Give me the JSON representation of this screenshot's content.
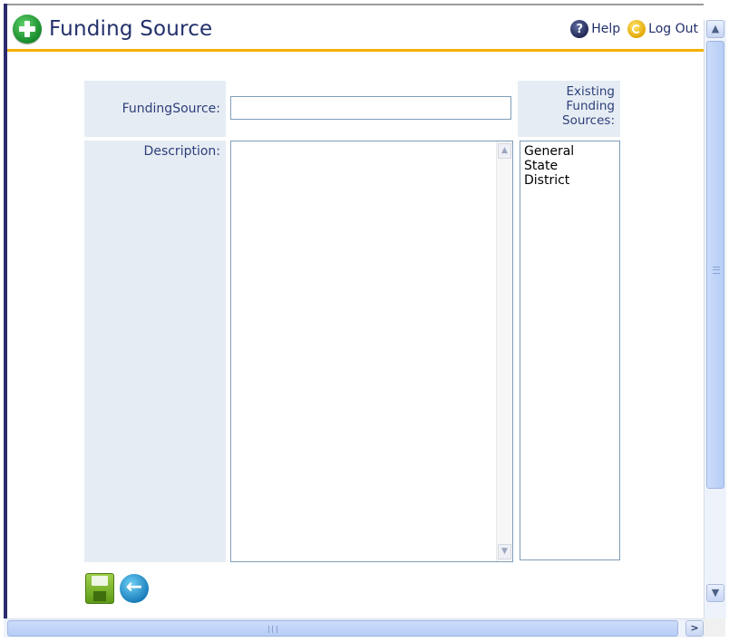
{
  "header": {
    "title": "Funding Source",
    "help_label": "Help",
    "logout_label": "Log Out",
    "icons": {
      "title": "add-icon",
      "help": "help-icon",
      "logout": "logout-icon"
    },
    "accent_color": "#f5b000",
    "title_color": "#22306b"
  },
  "form": {
    "funding_source_label": "FundingSource:",
    "funding_source_value": "",
    "description_label": "Description:",
    "description_value": "",
    "existing_label": "Existing Funding Sources:",
    "existing_items": [
      "General",
      "State",
      "District"
    ],
    "label_background": "#e6ecf3"
  },
  "actions": {
    "save_icon": "save-icon",
    "back_icon": "back-icon"
  }
}
